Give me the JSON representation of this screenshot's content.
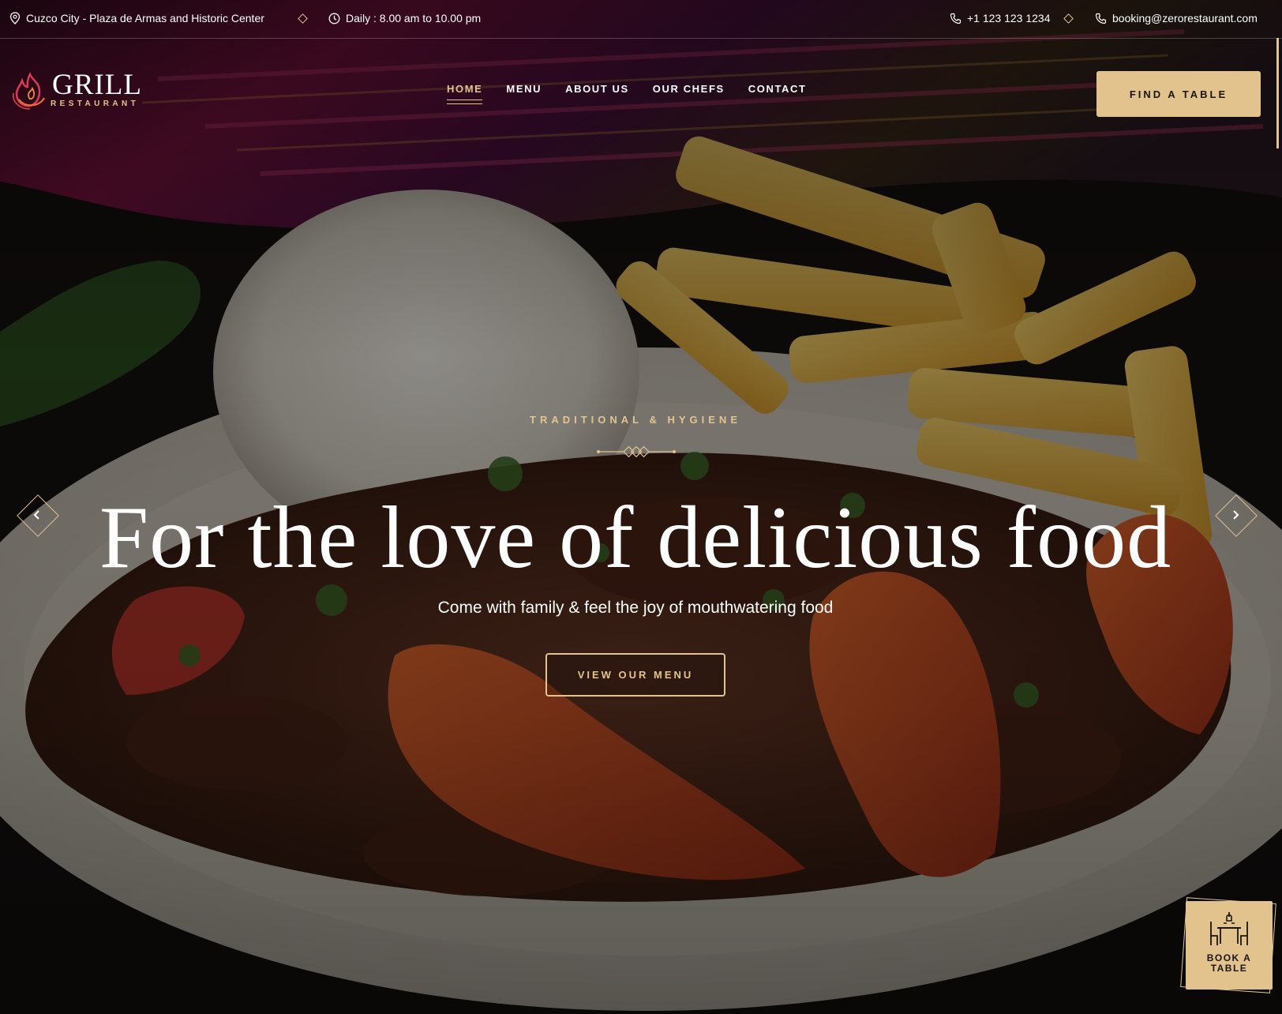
{
  "topbar": {
    "address": "Cuzco City - Plaza de Armas and Historic Center",
    "hours": "Daily : 8.00 am to 10.00 pm",
    "phone": "+1 123 123 1234",
    "email": "booking@zerorestaurant.com"
  },
  "logo": {
    "word": "GRILL",
    "sub": "RESTAURANT"
  },
  "nav": {
    "items": [
      {
        "label": "HOME",
        "active": true
      },
      {
        "label": "MENU"
      },
      {
        "label": "ABOUT US"
      },
      {
        "label": "OUR CHEFS"
      },
      {
        "label": "CONTACT"
      }
    ],
    "cta": "FIND A TABLE"
  },
  "hero": {
    "eyebrow": "TRADITIONAL & HYGIENE",
    "headline": "For the love of delicious food",
    "subline": "Come with family & feel the joy of mouthwatering food",
    "button": "VIEW OUR MENU"
  },
  "book_widget": {
    "line1": "BOOK A",
    "line2": "TABLE"
  },
  "colors": {
    "accent": "#e3c48f",
    "button_bg": "#e2c38e"
  },
  "icons": [
    "location-pin-icon",
    "clock-icon",
    "phone-icon",
    "diamond-separator-icon",
    "flame-logo-icon",
    "chevron-left-icon",
    "chevron-right-icon",
    "dining-table-icon"
  ]
}
